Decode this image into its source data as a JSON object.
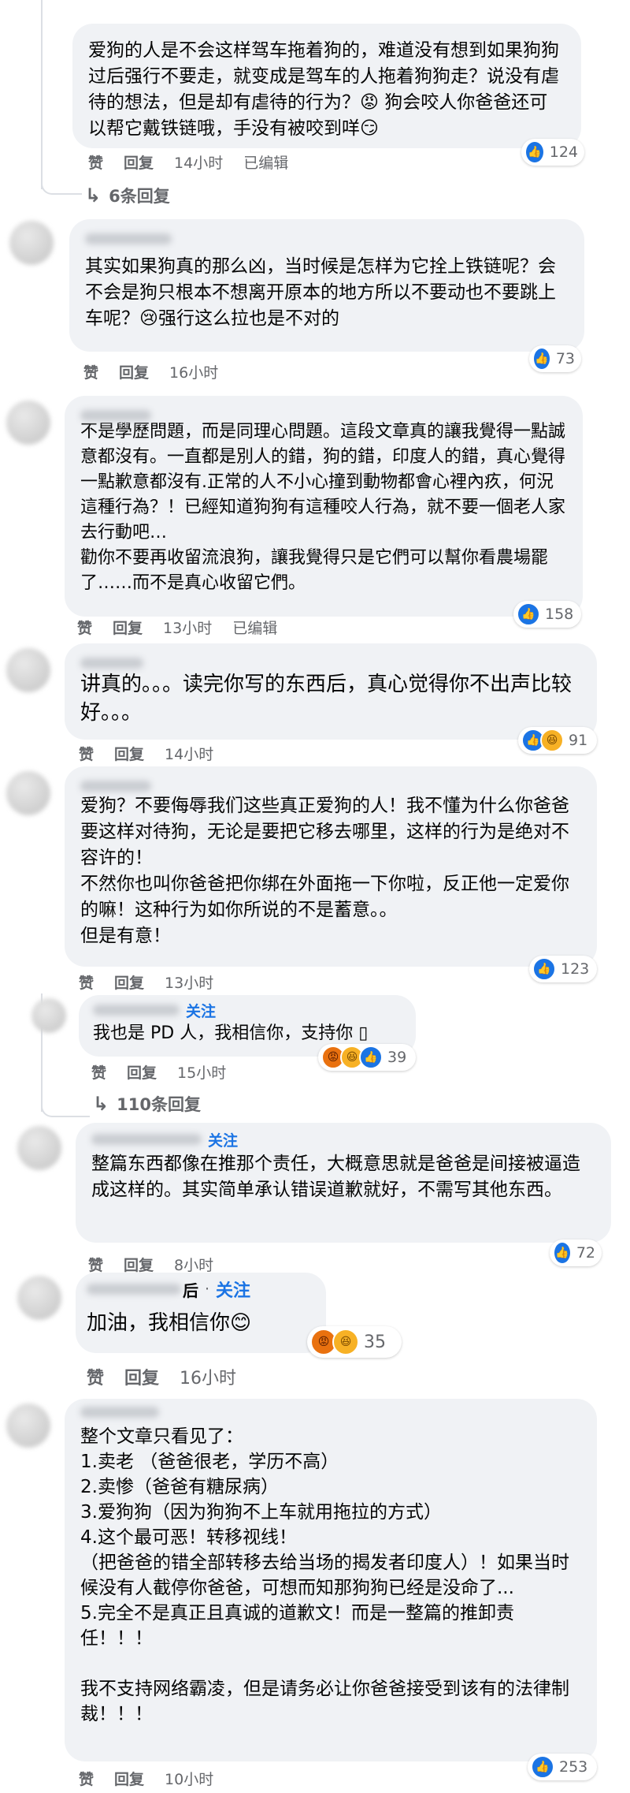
{
  "comments": [
    {
      "id": "c1",
      "text": "爱狗的人是不会这样驾车拖着狗的，难道没有想到如果狗狗过后强行不要走，就变成是驾车的人拖着狗狗走？说没有虐待的想法，但是却有虐待的行为？😡 狗会咬人你爸爸还可以帮它戴铁链哦，手没有被咬到咩😏",
      "reaction_count": "124",
      "actions": {
        "like": "赞",
        "reply": "回复",
        "time": "14小时",
        "edited": "已编辑"
      },
      "replies_label": "6条回复"
    },
    {
      "id": "c2",
      "text": "其实如果狗真的那么凶，当时候是怎样为它拴上铁链呢？会不会是狗只根本不想离开原本的地方所以不要动也不要跳上车呢？😢强行这么拉也是不对的",
      "reaction_count": "73",
      "actions": {
        "like": "赞",
        "reply": "回复",
        "time": "16小时"
      }
    },
    {
      "id": "c3",
      "text": "不是學歷問題，而是同理心問題。這段文章真的讓我覺得一點誠意都沒有。一直都是別人的錯，狗的錯，印度人的錯，真心覺得一點歉意都沒有.正常的人不小心撞到動物都會心裡內疚，何況這種行為？！已經知道狗狗有這種咬人行為，就不要一個老人家去行動吧…\n勸你不要再收留流浪狗，讓我覺得只是它們可以幫你看農場罷了……而不是真心收留它們。",
      "reaction_count": "158",
      "actions": {
        "like": "赞",
        "reply": "回复",
        "time": "13小时",
        "edited": "已编辑"
      }
    },
    {
      "id": "c4",
      "text": "讲真的。。。读完你写的东西后，真心觉得你不出声比较好。。。",
      "reaction_count": "91",
      "actions": {
        "like": "赞",
        "reply": "回复",
        "time": "14小时"
      }
    },
    {
      "id": "c5",
      "text": "爱狗？不要侮辱我们这些真正爱狗的人！我不懂为什么你爸爸要这样对待狗，无论是要把它移去哪里，这样的行为是绝对不容许的！\n不然你也叫你爸爸把你绑在外面拖一下你啦，反正他一定爱你的嘛！这种行为如你所说的不是蓄意。。\n但是有意！",
      "reaction_count": "123",
      "actions": {
        "like": "赞",
        "reply": "回复",
        "time": "13小时"
      }
    },
    {
      "id": "c6",
      "follow": "关注",
      "text": "我也是 PD 人，我相信你，支持你 ▯",
      "reaction_count": "39",
      "actions": {
        "like": "赞",
        "reply": "回复",
        "time": "15小时"
      },
      "replies_label": "110条回复"
    },
    {
      "id": "c7",
      "follow": "关注",
      "text": "整篇东西都像在推那个责任，大概意思就是爸爸是间接被逼造成这样的。其实简单承认错误道歉就好，不需写其他东西。",
      "reaction_count": "72",
      "actions": {
        "like": "赞",
        "reply": "回复",
        "time": "8小时"
      }
    },
    {
      "id": "c8",
      "name_visible": "后",
      "follow": "关注",
      "text": "加油，我相信你😊",
      "reaction_count": "35",
      "actions": {
        "like": "赞",
        "reply": "回复",
        "time": "16小时"
      }
    },
    {
      "id": "c9",
      "text": "整个文章只看见了：\n1.卖老 （爸爸很老，学历不高）\n2.卖惨（爸爸有糖尿病）\n3.爱狗狗（因为狗狗不上车就用拖拉的方式）\n4.这个最可恶！转移视线！\n（把爸爸的错全部转移去给当场的揭发者印度人）！如果当时候没有人截停你爸爸，可想而知那狗狗已经是没命了...\n5.完全不是真正且真诚的道歉文！而是一整篇的推卸责任！！！\n\n我不支持网络霸凌，但是请务必让你爸爸接受到该有的法律制裁！！！",
      "reaction_count": "253",
      "actions": {
        "like": "赞",
        "reply": "回复",
        "time": "10小时"
      }
    }
  ],
  "icons": {
    "like": "like-reaction-icon",
    "haha": "haha-reaction-icon",
    "angry": "angry-reaction-icon",
    "reply_arrow": "reply-arrow-icon"
  },
  "colors": {
    "bubble": "#f0f2f5",
    "like_blue": "#1b74e4",
    "meta_gray": "#65676b",
    "follow_blue": "#1b74e4"
  }
}
